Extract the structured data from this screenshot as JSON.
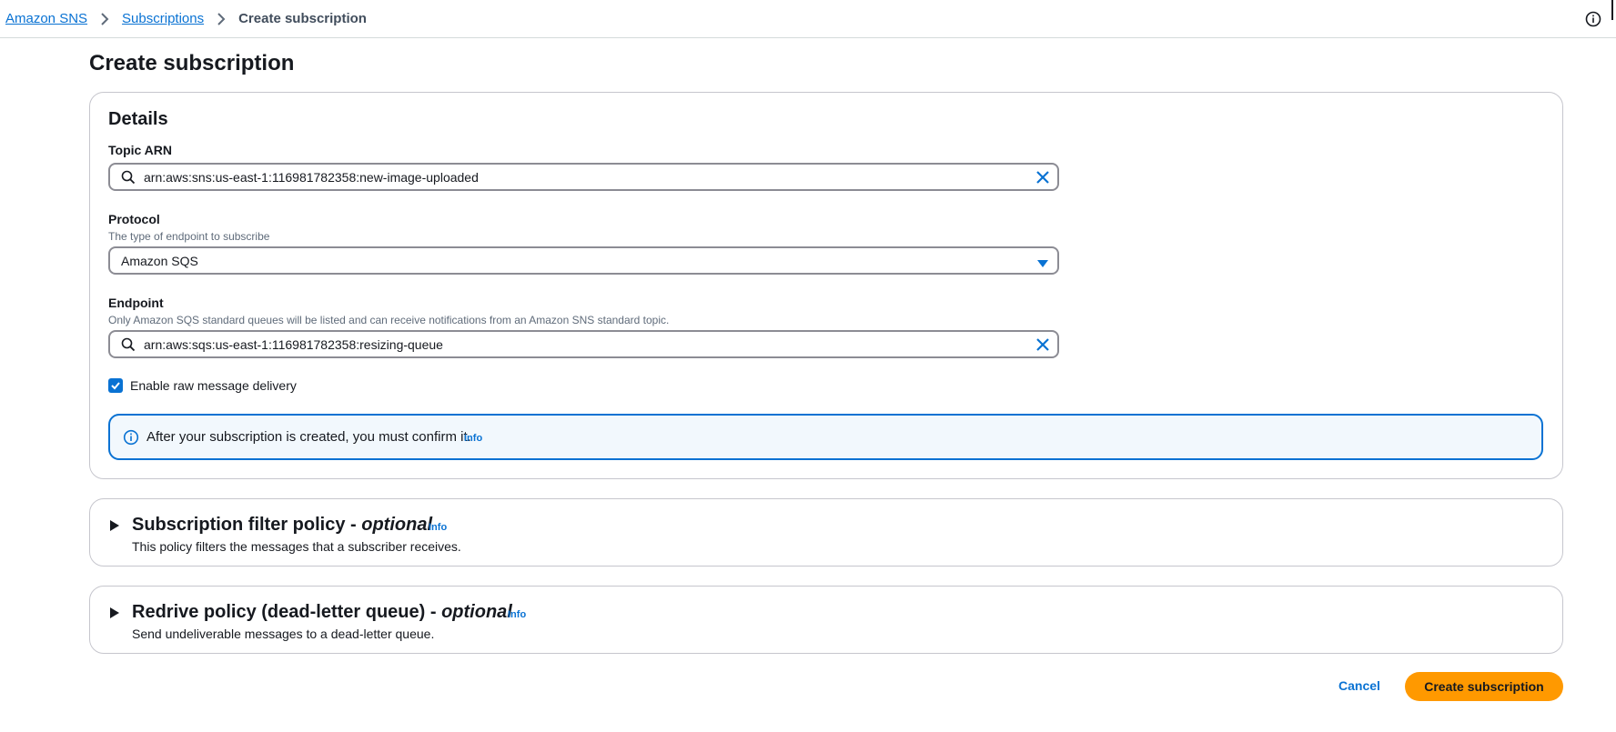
{
  "breadcrumb": {
    "items": [
      "Amazon SNS",
      "Subscriptions"
    ],
    "current": "Create subscription"
  },
  "page": {
    "title": "Create subscription"
  },
  "details": {
    "title": "Details",
    "topic_arn": {
      "label": "Topic ARN",
      "value": "arn:aws:sns:us-east-1:116981782358:new-image-uploaded"
    },
    "protocol": {
      "label": "Protocol",
      "description": "The type of endpoint to subscribe",
      "value": "Amazon SQS"
    },
    "endpoint": {
      "label": "Endpoint",
      "description": "Only Amazon SQS standard queues will be listed and can receive notifications from an Amazon SNS standard topic.",
      "value": "arn:aws:sqs:us-east-1:116981782358:resizing-queue"
    },
    "raw_delivery": {
      "label": "Enable raw message delivery",
      "checked": true
    },
    "alert": {
      "text": "After your subscription is created, you must confirm it.",
      "info": "Info"
    }
  },
  "filter_policy": {
    "title": "Subscription filter policy - ",
    "optional": "optional",
    "info": "Info",
    "description": "This policy filters the messages that a subscriber receives."
  },
  "redrive_policy": {
    "title": "Redrive policy (dead-letter queue) - ",
    "optional": "optional",
    "info": "Info",
    "description": "Send undeliverable messages to a dead-letter queue."
  },
  "footer": {
    "cancel": "Cancel",
    "create": "Create subscription"
  },
  "colors": {
    "accent": "#0972d3",
    "primary_button": "#ff9900",
    "alert_bg": "#f2f8fd"
  },
  "icons": [
    "chevron-right-icon",
    "info-icon",
    "search-icon",
    "close-icon",
    "caret-down-icon",
    "check-icon",
    "caret-right-icon"
  ]
}
